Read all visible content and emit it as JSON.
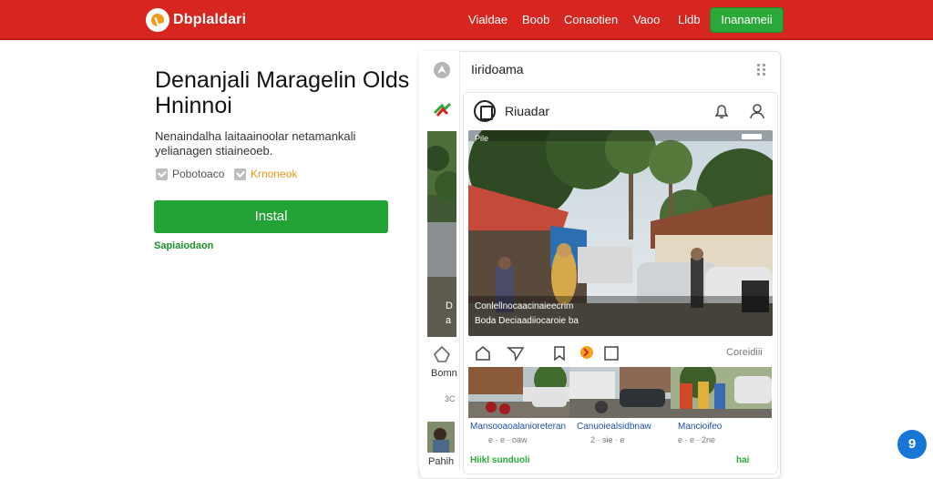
{
  "header": {
    "brand": "Dbplaldari",
    "nav": [
      {
        "label": "Vialdae"
      },
      {
        "label": "Boob"
      },
      {
        "label": "Conaotien"
      },
      {
        "label": "Vaoo"
      },
      {
        "label": "Lldb"
      }
    ],
    "cta": "Inanameii"
  },
  "hero": {
    "title": "Denanjali Maragelin Olds Hninnoi",
    "description": "Nenaindalha laitaainoolar netamankali yelianagen stiaineoeb.",
    "features": [
      {
        "label": "Pobotoaco"
      },
      {
        "label": "Krnoneok"
      }
    ],
    "install_label": "Instal",
    "sub_link": "Sapiaiodaon"
  },
  "phone": {
    "header_title": "Iiridoama",
    "side_labels": [
      "Bomn",
      "3C",
      "Pahih"
    ],
    "side_overlay": [
      "D",
      "a"
    ],
    "card": {
      "author": "Riuadar",
      "photo_status_left": "Pile",
      "photo_caption_1": "Conlellnocaacinaieecrim",
      "photo_caption_2": "Boda Deciaadiiocaroie ba",
      "action_label": "Coreidiii",
      "thumbnails": [
        {
          "caption": "Mansooaoalanioreteran",
          "meta": "e · e · oaw"
        },
        {
          "caption": "Canuoiealsidbnaw",
          "meta": "2 · sie · e"
        },
        {
          "caption": "Mancioifeo",
          "meta": "e · e · 2ne"
        }
      ],
      "footer_left": "Hiikl sunduoli",
      "footer_right": "hai"
    }
  },
  "fab_label": "9",
  "colors": {
    "header_red": "#d7261f",
    "accent_green": "#2aa838",
    "link_blue": "#1e4fa8",
    "fab_blue": "#1877d6"
  }
}
